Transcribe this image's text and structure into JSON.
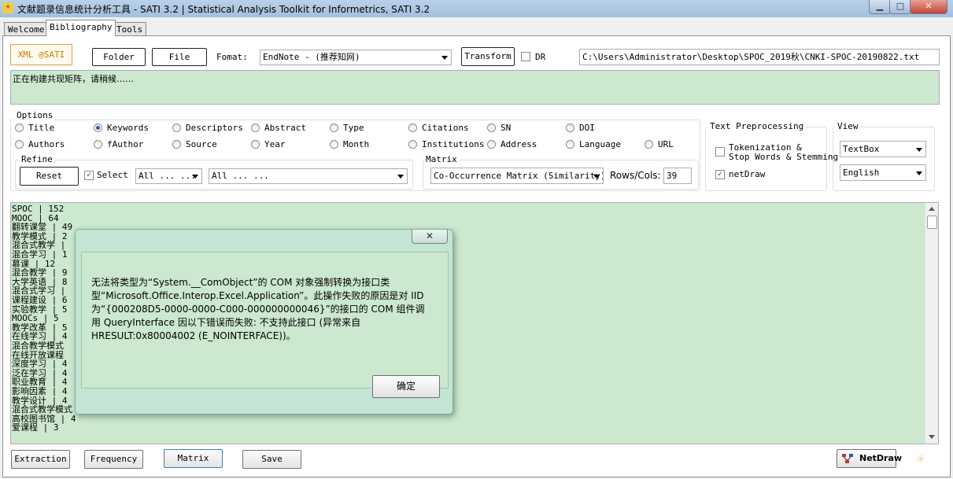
{
  "window": {
    "title": "文献题录信息统计分析工具 - SATI 3.2 | Statistical Analysis Toolkit for Informetrics, SATI 3.2",
    "minimize": "▁",
    "maximize": "□",
    "close": "✕"
  },
  "tabs": [
    {
      "label": "Welcome"
    },
    {
      "label": "Bibliography"
    },
    {
      "label": "Tools"
    }
  ],
  "top": {
    "xml_label": "XML @SATI",
    "folder_button": "Folder",
    "file_button": "File",
    "format_label": "Fomat:",
    "format_value": "EndNote  - (推荐知网)",
    "transform_button": "Transform",
    "dr_label": "DR",
    "path_value": "C:\\Users\\Administrator\\Desktop\\SPOC_2019秋\\CNKI-SPOC-20190822.txt",
    "status_text": "正在构建共现矩阵，请稍候……"
  },
  "options": {
    "label": "Options",
    "fields": [
      {
        "label": "Title",
        "checked": false
      },
      {
        "label": "Keywords",
        "checked": true
      },
      {
        "label": "Descriptors",
        "checked": false
      },
      {
        "label": "Abstract",
        "checked": false
      },
      {
        "label": "Type",
        "checked": false
      },
      {
        "label": "Citations",
        "checked": false
      },
      {
        "label": "SN",
        "checked": false
      },
      {
        "label": "DOI",
        "checked": false
      },
      {
        "label": "Authors",
        "checked": false
      },
      {
        "label": "fAuthor",
        "checked": false
      },
      {
        "label": "Source",
        "checked": false
      },
      {
        "label": "Year",
        "checked": false
      },
      {
        "label": "Month",
        "checked": false
      },
      {
        "label": "Institutions",
        "checked": false
      },
      {
        "label": "Address",
        "checked": false
      },
      {
        "label": "Language",
        "checked": false
      },
      {
        "label": "URL",
        "checked": false
      }
    ]
  },
  "refine": {
    "label": "Refine",
    "reset_button": "Reset",
    "select_label": "Select",
    "select_checked": true,
    "combo1_value": "All ... ... ...",
    "combo2_value": "All ... ..."
  },
  "matrix": {
    "label": "Matrix",
    "type_value": "Co-Occurrence Matrix (Similarity)",
    "rows_cols_label": "Rows/Cols:",
    "rows_cols_value": "39"
  },
  "text_preprocessing": {
    "label": "Text Preprocessing",
    "tokenization_label": "Tokenization &",
    "tokenization_label2": "Stop Words & Stemming",
    "tokenization_checked": false,
    "netdraw_label": "netDraw",
    "netdraw_checked": true
  },
  "view": {
    "label": "View",
    "display_value": "TextBox",
    "language_value": "English"
  },
  "results": {
    "lines": [
      "SPOC | 152",
      "MOOC | 64",
      "翻转课堂 | 49",
      "教学模式 | 2",
      "混合式教学 |",
      "混合学习 | 1",
      "慕课 | 12",
      "混合教学 | 9",
      "大学英语 | 8",
      "混合式学习 |",
      "课程建设 | 6",
      "实验教学 | 5",
      "MOOCs | 5",
      "教学改革 | 5",
      "在线学习 | 4",
      "混合教学模式",
      "在线开放课程",
      "深度学习 | 4",
      "泛在学习 | 4",
      "职业教育 | 4",
      "影响因素 | 4",
      "教学设计 | 4",
      "混合式教学模式 | 4",
      "高校图书馆 | 4",
      "爱课程 | 3"
    ]
  },
  "bottom": {
    "extraction_button": "Extraction",
    "frequency_button": "Frequency",
    "matrix_button": "Matrix",
    "save_button": "Save",
    "netdraw_button": "NetDraw"
  },
  "dialog": {
    "message": "无法将类型为“System.__ComObject”的 COM 对象强制转换为接口类型“Microsoft.Office.Interop.Excel.Application”。此操作失败的原因是对 IID 为“{000208D5-0000-0000-C000-000000000046}”的接口的 COM 组件调用 QueryInterface 因以下错误而失败: 不支持此接口 (异常来自 HRESULT:0x80004002 (E_NOINTERFACE))。",
    "ok_button": "确定",
    "close": "✕"
  }
}
